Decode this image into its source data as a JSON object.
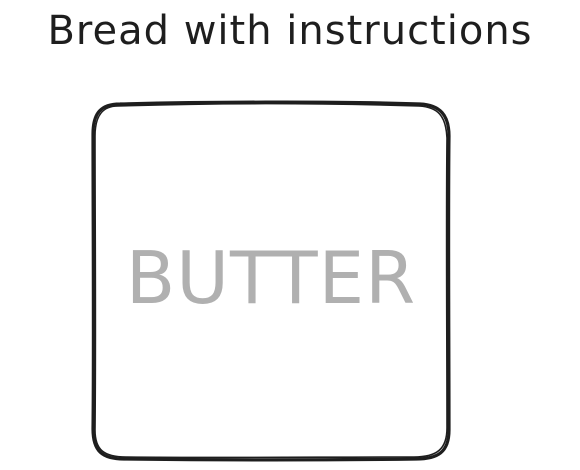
{
  "title": "Bread with instructions",
  "bread": {
    "label": "BUTTER",
    "outline_color": "#1e1e1e",
    "label_color": "#b0b0b0"
  }
}
